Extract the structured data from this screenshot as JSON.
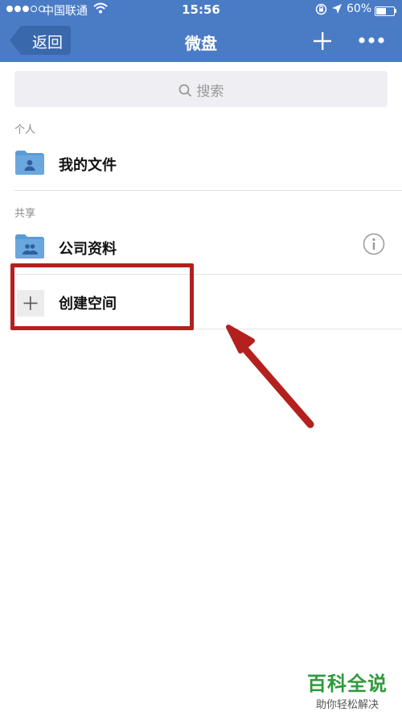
{
  "status_bar": {
    "carrier": "中国联通",
    "time": "15:56",
    "battery": "60%",
    "battery_level": 0.6
  },
  "nav": {
    "back_label": "返回",
    "title": "微盘",
    "add_icon": "plus-icon",
    "more_icon": "more-icon"
  },
  "search": {
    "placeholder": "搜索",
    "icon": "search-icon"
  },
  "sections": {
    "personal": {
      "label": "个人",
      "items": [
        {
          "label": "我的文件",
          "icon": "personal-folder-icon"
        }
      ]
    },
    "shared": {
      "label": "共享",
      "items": [
        {
          "label": "公司资料",
          "icon": "shared-folder-icon",
          "action_icon": "info-icon"
        },
        {
          "label": "创建空间",
          "icon": "plus-icon"
        }
      ]
    }
  },
  "annotation": {
    "color": "#b3201e"
  },
  "watermark": {
    "main": "百科全说",
    "sub": "助你轻松解决"
  },
  "colors": {
    "header": "#4a7cc6",
    "folder": "#5b9bd5"
  }
}
